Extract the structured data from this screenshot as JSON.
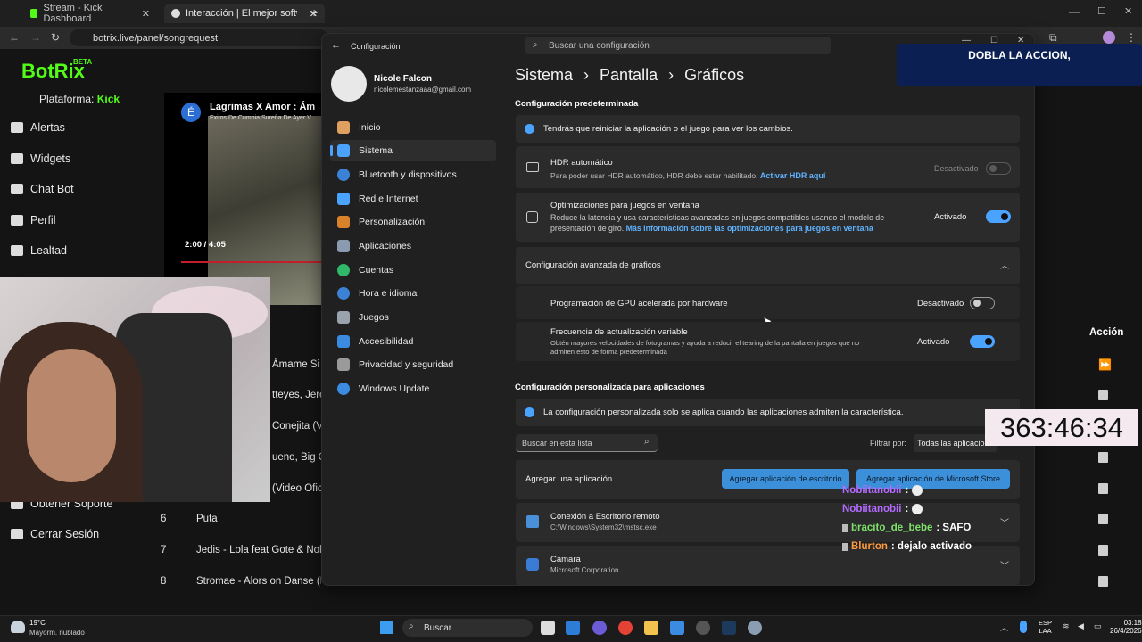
{
  "browser": {
    "tabs": [
      "Stream - Kick Dashboard",
      "Interacción | El mejor software"
    ],
    "url": "botrix.live/panel/songrequest"
  },
  "botrix": {
    "logo": "BotRix",
    "beta": "BETA",
    "platform_label": "Plataforma:",
    "platform": "Kick",
    "nav": [
      "Alertas",
      "Widgets",
      "Chat Bot",
      "Perfil",
      "Lealtad"
    ],
    "support": "Obtener Soporte",
    "logout": "Cerrar Sesión",
    "video_title": "Lagrimas X Amor : Ám",
    "video_sub": "Exitos De Cumbia Sureña De Ayer V",
    "video_avatar": "É",
    "video_time": "2:00 / 4:05",
    "action_header": "Acción",
    "partials": [
      "Ámame Si",
      "tteyes, Jere",
      "Conejita (V",
      "ueno, Big On",
      "(Video Ofici"
    ],
    "songs": [
      {
        "n": "6",
        "t": "Puta"
      },
      {
        "n": "7",
        "t": "Jedis - Lola feat Gote & Nolep"
      },
      {
        "n": "8",
        "t": "Stromae - Alors on Danse (Lyr"
      }
    ]
  },
  "overlay": {
    "banner": "DOBLA LA ACCION,",
    "timer": "363:46:34",
    "chat": [
      {
        "user": "Nobiitanobii",
        "msg": ":",
        "color": "#b46bff"
      },
      {
        "user": "Nobiitanobii",
        "msg": ":",
        "color": "#b46bff"
      },
      {
        "user": "bracito_de_bebe",
        "msg": ": SAFO",
        "color": "#7ee06a"
      },
      {
        "user": "Blurton",
        "msg": ": dejalo activado",
        "color": "#ff9b3d"
      }
    ]
  },
  "settings": {
    "app_title": "Configuración",
    "search_placeholder": "Buscar una configuración",
    "user_name": "Nicole Falcon",
    "user_email": "nicolemestanzaaa@gmail.com",
    "menu": [
      "Inicio",
      "Sistema",
      "Bluetooth y dispositivos",
      "Red e Internet",
      "Personalización",
      "Aplicaciones",
      "Cuentas",
      "Hora e idioma",
      "Juegos",
      "Accesibilidad",
      "Privacidad y seguridad",
      "Windows Update"
    ],
    "breadcrumb": [
      "Sistema",
      "Pantalla",
      "Gráficos"
    ],
    "default_header": "Configuración predeterminada",
    "restart_info": "Tendrás que reiniciar la aplicación o el juego para ver los cambios.",
    "hdr_title": "HDR automático",
    "hdr_desc": "Para poder usar HDR automático, HDR debe estar habilitado.",
    "hdr_link": "Activar HDR aquí",
    "hdr_state": "Desactivado",
    "win_title": "Optimizaciones para juegos en ventana",
    "win_desc1": "Reduce la latencia y usa características avanzadas en juegos compatibles usando el modelo de",
    "win_desc2": "presentación de giro.",
    "win_link": "Más información sobre las optimizaciones para juegos en ventana",
    "win_state": "Activado",
    "adv_header": "Configuración avanzada de gráficos",
    "gpu_title": "Programación de GPU acelerada por hardware",
    "gpu_state": "Desactivado",
    "vrr_title": "Frecuencia de actualización variable",
    "vrr_desc1": "Obtén mayores velocidades de fotogramas y ayuda a reducir el tearing de la pantalla en juegos que no",
    "vrr_desc2": "admiten esto de forma predeterminada",
    "vrr_state": "Activado",
    "custom_header": "Configuración personalizada para aplicaciones",
    "custom_info": "La configuración personalizada solo se aplica cuando las aplicaciones admiten la característica.",
    "list_search": "Buscar en esta lista",
    "filter_label": "Filtrar por:",
    "filter_value": "Todas las aplicaciones",
    "add_app": "Agregar una aplicación",
    "add_desktop": "Agregar aplicación de escritorio",
    "add_store": "Agregar aplicación de Microsoft Store",
    "apps": [
      {
        "name": "Conexión a Escritorio remoto",
        "path": "C:\\Windows\\System32\\mstsc.exe"
      },
      {
        "name": "Cámara",
        "path": "Microsoft Corporation"
      }
    ]
  },
  "taskbar": {
    "temp": "19°C",
    "weather": "Mayorm. nublado",
    "search": "Buscar",
    "lang1": "ESP",
    "lang2": "LAA",
    "time": "03:18",
    "date": "26/4/2026"
  }
}
